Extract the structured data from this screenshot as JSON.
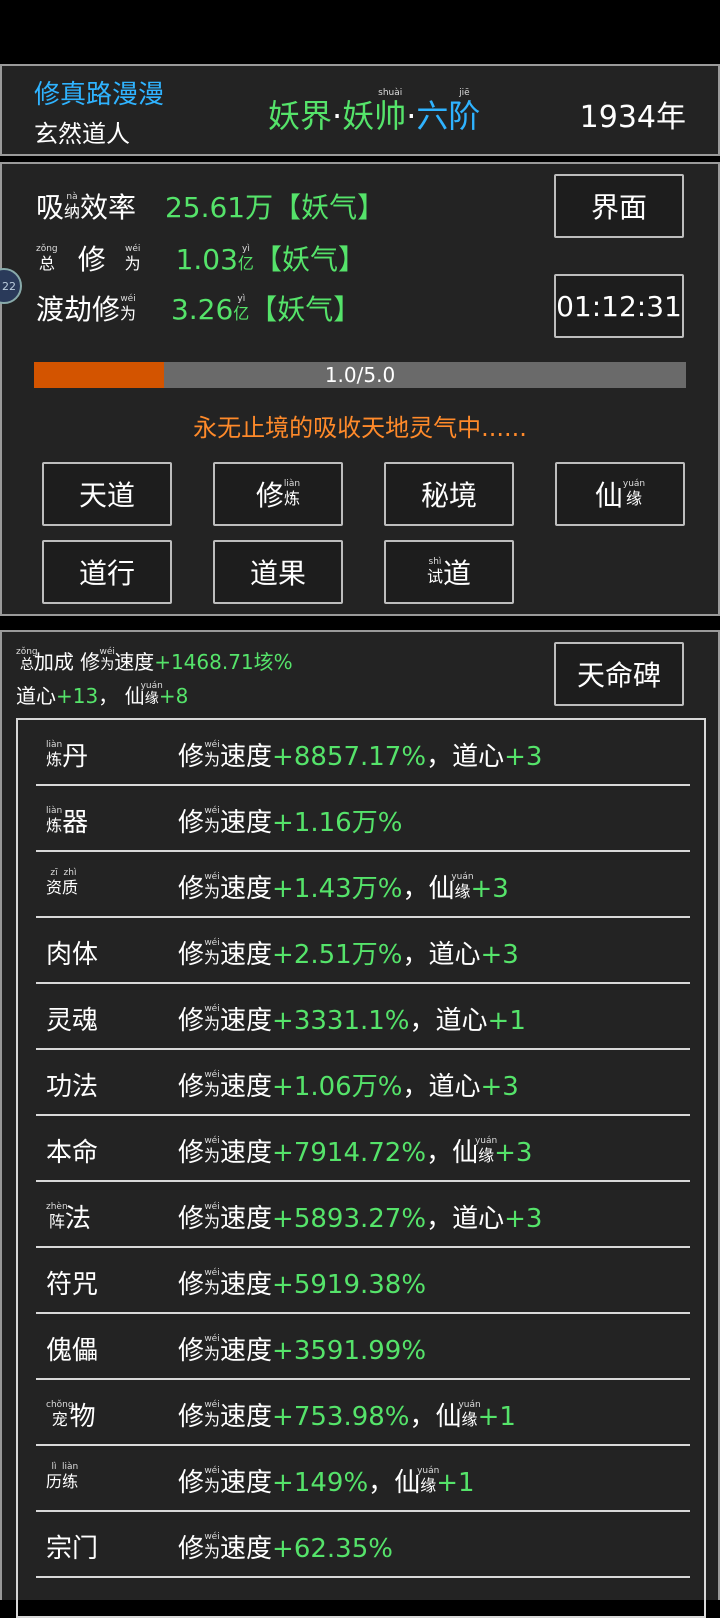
{
  "header": {
    "game_title": "修真路漫漫",
    "player_name": "玄然道人",
    "realm_a": "妖界",
    "realm_dot1": "·",
    "realm_b": "妖",
    "realm_c": "帅",
    "realm_c_pinyin": "shuài",
    "realm_dot2": "·",
    "realm_d": "六",
    "realm_e": "阶",
    "realm_e_pinyin": "jiē",
    "year": "1934年"
  },
  "stats": {
    "absorb_label_a": "吸",
    "absorb_label_b": "纳",
    "absorb_label_b_pinyin": "nà",
    "absorb_label_c": "效率",
    "absorb_value": "25.61万【妖气】",
    "total_label_a": "总",
    "total_label_a_pinyin": "zǒng",
    "total_label_b": "修",
    "total_label_c": "为",
    "total_label_c_pinyin": "wéi",
    "total_value": "1.03",
    "total_unit": "亿",
    "total_unit_pinyin": "yì",
    "total_suffix": "【妖气】",
    "tribulation_label_a": "渡劫修",
    "tribulation_label_b": "为",
    "tribulation_label_b_pinyin": "wéi",
    "tribulation_value": "3.26",
    "tribulation_unit": "亿",
    "tribulation_unit_pinyin": "yì",
    "tribulation_suffix": "【妖气】",
    "side_badge": "22"
  },
  "buttons": {
    "interface": "界面",
    "timer": "01:12:31"
  },
  "progress": {
    "text": "1.0/5.0",
    "fraction": 0.2,
    "fill_color": "#d35400"
  },
  "status_message": "永无止境的吸收天地灵气中......",
  "menu": {
    "tiandao": "天道",
    "xiu": "修",
    "lian": "炼",
    "lian_pinyin": "liàn",
    "mijing": "秘境",
    "xian": "仙",
    "yuan": "缘",
    "yuan_pinyin": "yuán",
    "daoxing": "道行",
    "daoguo": "道果",
    "shi": "试",
    "shi_pinyin": "shì",
    "dao": "道"
  },
  "bonus": {
    "total_a": "总",
    "total_a_pinyin": "zǒng",
    "total_b": "加成 修",
    "total_c": "为",
    "total_c_pinyin": "wéi",
    "total_d": "速度",
    "total_value": "+1468.71垓%",
    "daoxin_label": "道心",
    "daoxin_value": "+13",
    "sep": "，",
    "xian": "仙",
    "yuan": "缘",
    "yuan_pinyin": "yuán",
    "xianyuan_value": "+8",
    "tianming_button": "天命碑"
  },
  "list": [
    {
      "name_a": "炼",
      "name_a_py": "liàn",
      "name_b": "丹",
      "name_b_py": "",
      "speed": "+8857.17%",
      "extra_label": "道心",
      "extra_py": "",
      "extra_label2": "",
      "extra_value": "+3"
    },
    {
      "name_a": "炼",
      "name_a_py": "liàn",
      "name_b": "器",
      "name_b_py": "",
      "speed": "+1.16万%",
      "extra_label": "",
      "extra_py": "",
      "extra_label2": "",
      "extra_value": ""
    },
    {
      "name_a": "资",
      "name_a_py": "zī",
      "name_b": "质",
      "name_b_py": "zhì",
      "speed": "+1.43万%",
      "extra_label": "仙",
      "extra_py": "yuán",
      "extra_label2": "缘",
      "extra_value": "+3"
    },
    {
      "name_a": "肉体",
      "name_a_py": "",
      "name_b": "",
      "name_b_py": "",
      "speed": "+2.51万%",
      "extra_label": "道心",
      "extra_py": "",
      "extra_label2": "",
      "extra_value": "+3"
    },
    {
      "name_a": "灵魂",
      "name_a_py": "",
      "name_b": "",
      "name_b_py": "",
      "speed": "+3331.1%",
      "extra_label": "道心",
      "extra_py": "",
      "extra_label2": "",
      "extra_value": "+1"
    },
    {
      "name_a": "功法",
      "name_a_py": "",
      "name_b": "",
      "name_b_py": "",
      "speed": "+1.06万%",
      "extra_label": "道心",
      "extra_py": "",
      "extra_label2": "",
      "extra_value": "+3"
    },
    {
      "name_a": "本命",
      "name_a_py": "",
      "name_b": "",
      "name_b_py": "",
      "speed": "+7914.72%",
      "extra_label": "仙",
      "extra_py": "yuán",
      "extra_label2": "缘",
      "extra_value": "+3"
    },
    {
      "name_a": "阵",
      "name_a_py": "zhèn",
      "name_b": "法",
      "name_b_py": "",
      "speed": "+5893.27%",
      "extra_label": "道心",
      "extra_py": "",
      "extra_label2": "",
      "extra_value": "+3"
    },
    {
      "name_a": "符咒",
      "name_a_py": "",
      "name_b": "",
      "name_b_py": "",
      "speed": "+5919.38%",
      "extra_label": "",
      "extra_py": "",
      "extra_label2": "",
      "extra_value": ""
    },
    {
      "name_a": "傀儡",
      "name_a_py": "",
      "name_b": "",
      "name_b_py": "",
      "speed": "+3591.99%",
      "extra_label": "",
      "extra_py": "",
      "extra_label2": "",
      "extra_value": ""
    },
    {
      "name_a": "宠",
      "name_a_py": "chǒng",
      "name_b": "物",
      "name_b_py": "",
      "speed": "+753.98%",
      "extra_label": "仙",
      "extra_py": "yuán",
      "extra_label2": "缘",
      "extra_value": "+1"
    },
    {
      "name_a": "历",
      "name_a_py": "lì",
      "name_b": "练",
      "name_b_py": "liàn",
      "speed": "+149%",
      "extra_label": "仙",
      "extra_py": "yuán",
      "extra_label2": "缘",
      "extra_value": "+1"
    },
    {
      "name_a": "宗门",
      "name_a_py": "",
      "name_b": "",
      "name_b_py": "",
      "speed": "+62.35%",
      "extra_label": "",
      "extra_py": "",
      "extra_label2": "",
      "extra_value": ""
    }
  ],
  "list_common": {
    "xiu": "修",
    "wei": "为",
    "wei_pinyin": "wéi",
    "sudu": "速度",
    "sep": "，"
  }
}
